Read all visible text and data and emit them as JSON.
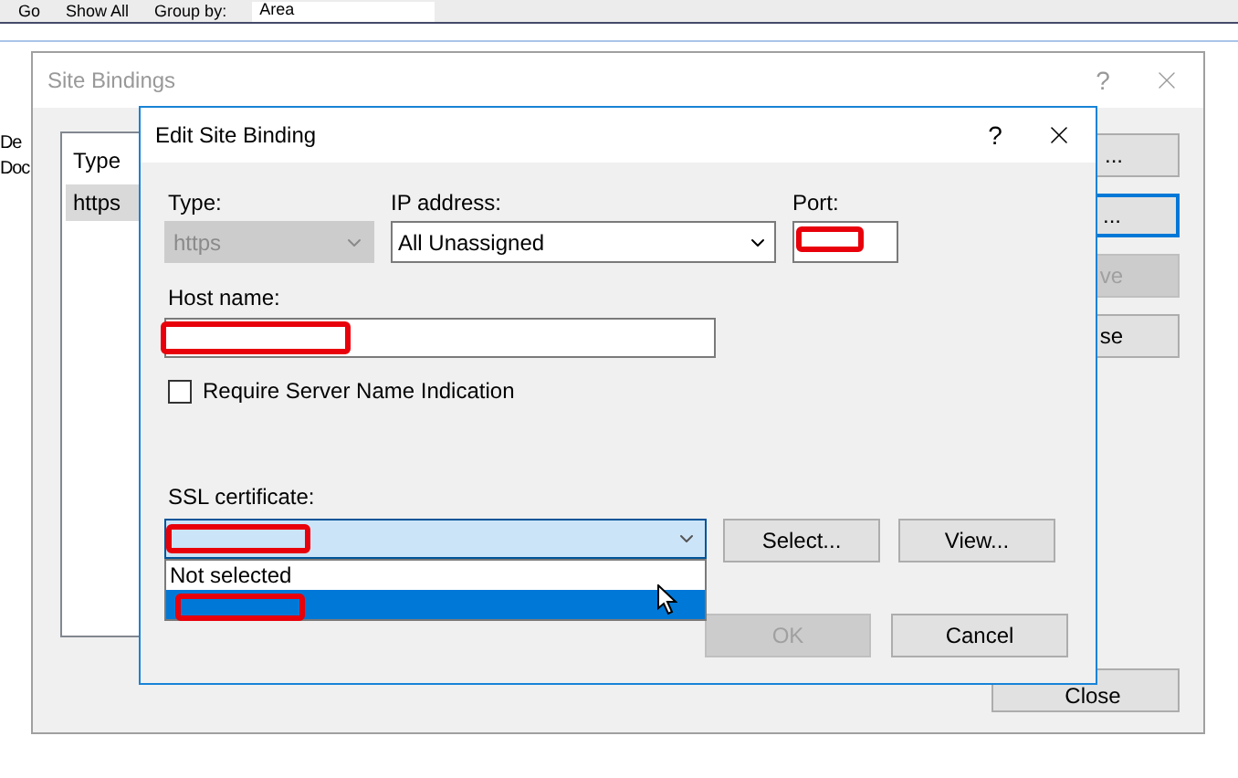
{
  "toolbar": {
    "items": [
      {
        "label": "Go"
      },
      {
        "label": "Show All"
      }
    ],
    "group_by_label": "Group by:",
    "group_by_value": "Area"
  },
  "background_labels": [
    "De",
    "Doc"
  ],
  "site_bindings": {
    "title": "Site Bindings",
    "help": "?",
    "columns": [
      "Type"
    ],
    "rows": [
      {
        "type": "https",
        "selected": true
      }
    ],
    "buttons": [
      {
        "label": "...",
        "disabled": false,
        "focused": false
      },
      {
        "label": "...",
        "disabled": false,
        "focused": true
      },
      {
        "label": "ve",
        "disabled": true,
        "focused": false
      },
      {
        "label": "se",
        "disabled": false,
        "focused": false
      }
    ],
    "close_button": {
      "label": "Close"
    }
  },
  "edit_dialog": {
    "title": "Edit Site Binding",
    "help": "?",
    "type": {
      "label": "Type:",
      "value": "https",
      "disabled": true
    },
    "ip_address": {
      "label": "IP address:",
      "value": "All Unassigned"
    },
    "port": {
      "label": "Port:"
    },
    "host_name": {
      "label": "Host name:"
    },
    "sni": {
      "label": "Require Server Name Indication",
      "checked": false
    },
    "ssl_certificate": {
      "label": "SSL certificate:",
      "expanded": true,
      "options": [
        {
          "label": "Not selected",
          "selected": false
        },
        {
          "selected": true
        }
      ]
    },
    "cert_buttons": [
      {
        "label": "Select...",
        "disabled": false
      },
      {
        "label": "View...",
        "disabled": false
      }
    ],
    "buttons": [
      {
        "label": "OK",
        "disabled": true
      },
      {
        "label": "Cancel",
        "disabled": false
      }
    ]
  }
}
